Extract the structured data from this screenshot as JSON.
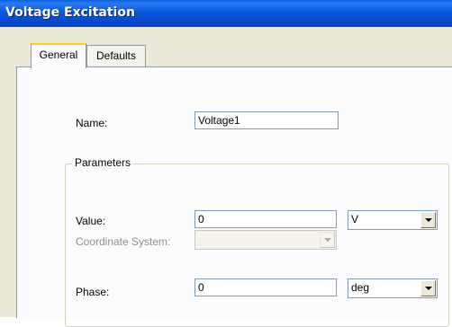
{
  "window": {
    "title": "Voltage Excitation"
  },
  "tabs": [
    {
      "label": "General",
      "active": true
    },
    {
      "label": "Defaults",
      "active": false
    }
  ],
  "form": {
    "name_label": "Name:",
    "name_value": "Voltage1",
    "parameters_group": "Parameters",
    "value_label": "Value:",
    "value_value": "0",
    "value_unit": "V",
    "coordinate_label": "Coordinate System:",
    "coordinate_value": "",
    "phase_label": "Phase:",
    "phase_value": "0",
    "phase_unit": "deg"
  },
  "icons": {
    "dropdown": "chevron-down-icon"
  }
}
